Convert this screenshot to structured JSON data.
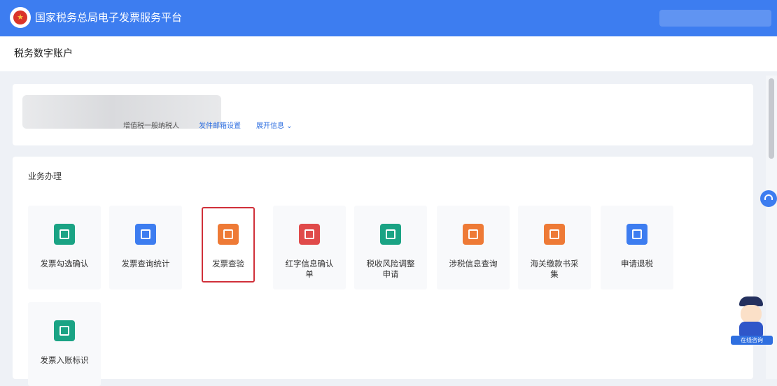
{
  "header": {
    "title": "国家税务总局电子发票服务平台"
  },
  "breadcrumb": {
    "title": "税务数字账户"
  },
  "account": {
    "taxpayer_type": "增值税一般纳税人",
    "links": [
      {
        "label": "发件邮箱设置"
      },
      {
        "label": "展开信息 ⌄"
      }
    ]
  },
  "business": {
    "title": "业务办理",
    "tiles": [
      {
        "label": "发票勾选确认",
        "color": "#1aa384",
        "icon": "check-confirm-icon"
      },
      {
        "label": "发票查询统计",
        "color": "#3d7df0",
        "icon": "query-stats-icon"
      },
      {
        "label": "发票查验",
        "color": "#ee7a36",
        "icon": "verify-icon",
        "selected": true
      },
      {
        "label": "红字信息确认单",
        "color": "#e04a4a",
        "icon": "red-letter-icon"
      },
      {
        "label": "税收风险调整申请",
        "color": "#1aa384",
        "icon": "adjust-apply-icon"
      },
      {
        "label": "涉税信息查询",
        "color": "#ee7a36",
        "icon": "tax-info-icon"
      },
      {
        "label": "海关缴款书采集",
        "color": "#ee7a36",
        "icon": "customs-icon"
      },
      {
        "label": "申请退税",
        "color": "#3d7df0",
        "icon": "refund-icon"
      },
      {
        "label": "发票入账标识",
        "color": "#1aa384",
        "icon": "entry-mark-icon"
      }
    ]
  },
  "mascot": {
    "label": "在线咨询"
  }
}
